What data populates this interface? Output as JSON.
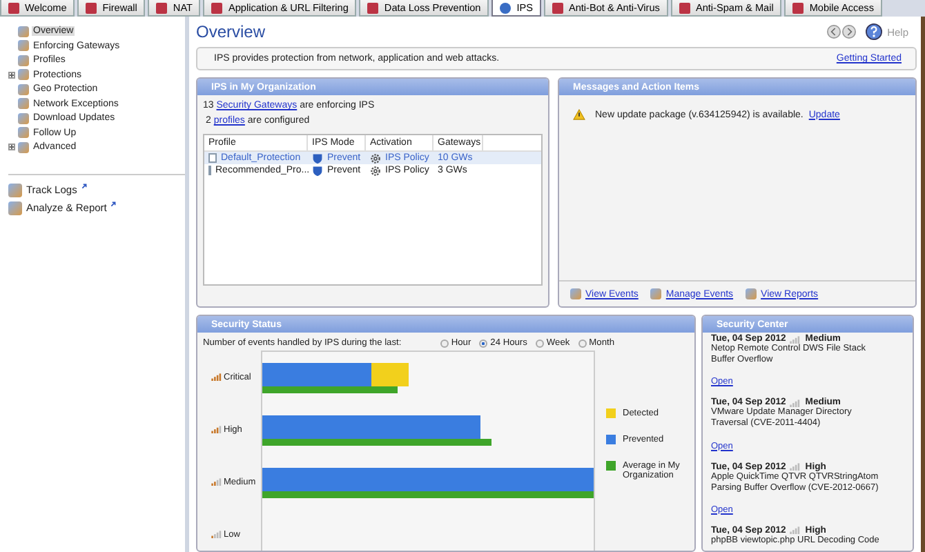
{
  "tabs": [
    {
      "label": "Welcome",
      "selected": false
    },
    {
      "label": "Firewall",
      "selected": false
    },
    {
      "label": "NAT",
      "selected": false
    },
    {
      "label": "Application & URL Filtering",
      "selected": false
    },
    {
      "label": "Data Loss Prevention",
      "selected": false
    },
    {
      "label": "IPS",
      "selected": true
    },
    {
      "label": "Anti-Bot & Anti-Virus",
      "selected": false
    },
    {
      "label": "Anti-Spam & Mail",
      "selected": false
    },
    {
      "label": "Mobile Access",
      "selected": false
    }
  ],
  "sidebar": {
    "items": [
      {
        "label": "Overview",
        "selected": true,
        "expandable": false
      },
      {
        "label": "Enforcing Gateways",
        "selected": false,
        "expandable": false
      },
      {
        "label": "Profiles",
        "selected": false,
        "expandable": false
      },
      {
        "label": "Protections",
        "selected": false,
        "expandable": true
      },
      {
        "label": "Geo Protection",
        "selected": false,
        "expandable": false
      },
      {
        "label": "Network Exceptions",
        "selected": false,
        "expandable": false
      },
      {
        "label": "Download Updates",
        "selected": false,
        "expandable": false
      },
      {
        "label": "Follow Up",
        "selected": false,
        "expandable": false
      },
      {
        "label": "Advanced",
        "selected": false,
        "expandable": true
      }
    ],
    "tools": [
      "Track Logs",
      "Analyze & Report"
    ]
  },
  "page": {
    "title": "Overview",
    "help": "Help"
  },
  "info": {
    "text": "IPS provides protection from network, application and web attacks.",
    "link": "Getting Started"
  },
  "organization": {
    "title": "IPS in My Organization",
    "gateways": {
      "count": "13",
      "link": "Security Gateways",
      "rest": "are enforcing IPS"
    },
    "profiles": {
      "count": "2",
      "link": "profiles",
      "rest": "are configured"
    },
    "columns": [
      "Profile",
      "IPS Mode",
      "Activation",
      "Gateways"
    ],
    "rows": [
      {
        "profile": "Default_Protection",
        "mode": "Prevent",
        "activation": "IPS Policy",
        "gateways": "10 GWs",
        "selected": true
      },
      {
        "profile": "Recommended_Pro...",
        "mode": "Prevent",
        "activation": "IPS Policy",
        "gateways": "3 GWs",
        "selected": false
      }
    ]
  },
  "messages": {
    "title": "Messages and Action Items",
    "items": [
      {
        "text": "New update package (v.634125942) is available.",
        "link": "Update"
      }
    ],
    "links": [
      "View Events",
      "Manage Events",
      "View Reports"
    ]
  },
  "security_status": {
    "title": "Security Status",
    "prompt": "Number of events handled by IPS during the last:",
    "periods": [
      {
        "label": "Hour",
        "selected": false
      },
      {
        "label": "24 Hours",
        "selected": true
      },
      {
        "label": "Week",
        "selected": false
      },
      {
        "label": "Month",
        "selected": false
      }
    ],
    "severities": [
      "Critical",
      "High",
      "Medium",
      "Low"
    ],
    "legend": [
      {
        "label": "Detected",
        "color": "#f2d01c"
      },
      {
        "label": "Prevented",
        "color": "#3a7de0"
      },
      {
        "label": "Average in My Organization",
        "color": "#3fa52a"
      }
    ]
  },
  "security_center": {
    "title": "Security Center",
    "items": [
      {
        "date": "Tue, 04 Sep 2012",
        "severity": "Medium",
        "text": "Netop Remote Control DWS File Stack Buffer Overflow",
        "link": "Open"
      },
      {
        "date": "Tue, 04 Sep 2012",
        "severity": "Medium",
        "text": "VMware Update Manager Directory Traversal (CVE-2011-4404)",
        "link": "Open"
      },
      {
        "date": "Tue, 04 Sep 2012",
        "severity": "High",
        "text": "Apple QuickTime QTVR QTVRStringAtom Parsing Buffer Overflow (CVE-2012-0667)",
        "link": "Open"
      },
      {
        "date": "Tue, 04 Sep 2012",
        "severity": "High",
        "text": "phpBB viewtopic.php URL Decoding Code"
      }
    ]
  }
}
